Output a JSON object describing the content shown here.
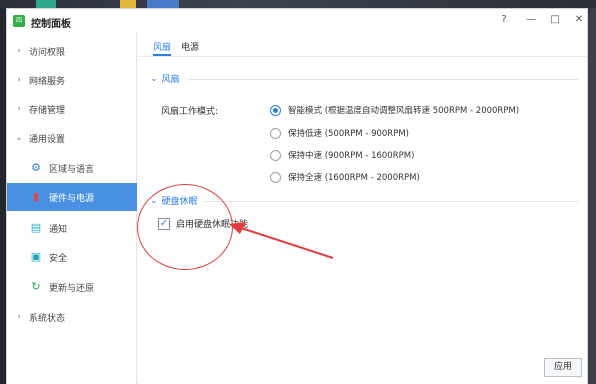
{
  "window": {
    "app_icon_text": "四",
    "title": "控制面板",
    "help_label": "?",
    "minimize_label": "—",
    "maximize_label": "□",
    "close_label": "✕"
  },
  "sidebar": {
    "items": [
      {
        "label": "访问权限",
        "arrow": "›"
      },
      {
        "label": "网络服务",
        "arrow": "›"
      },
      {
        "label": "存储管理",
        "arrow": "›"
      },
      {
        "label": "通用设置",
        "arrow": "⌄"
      },
      {
        "label": "区域与语言",
        "icon": "gear-icon"
      },
      {
        "label": "硬件与电源",
        "icon": "hardware-power-icon"
      },
      {
        "label": "通知",
        "icon": "chat-icon"
      },
      {
        "label": "安全",
        "icon": "security-icon"
      },
      {
        "label": "更新与还原",
        "icon": "refresh-icon"
      },
      {
        "label": "系统状态",
        "arrow": "›"
      }
    ]
  },
  "tabs": [
    {
      "label": "风扇"
    },
    {
      "label": "电源"
    }
  ],
  "fan_section": {
    "title": "风扇",
    "mode_label": "风扇工作模式:",
    "options": [
      {
        "label": "智能模式 (根据温度自动调整风扇转速 500RPM - 2000RPM)",
        "checked": true
      },
      {
        "label": "保持低速 (500RPM - 900RPM)",
        "checked": false
      },
      {
        "label": "保持中速 (900RPM - 1600RPM)",
        "checked": false
      },
      {
        "label": "保持全速 (1600RPM - 2000RPM)",
        "checked": false
      }
    ]
  },
  "disk_section": {
    "title": "硬盘休眠",
    "checkbox_label": "启用硬盘休眠功能",
    "checked": true,
    "check_mark": "✓"
  },
  "apply_label": "应用",
  "colors": {
    "accent": "#2b7de0",
    "active_sidebar": "#4a90e2",
    "annotation": "#e23b3b"
  }
}
